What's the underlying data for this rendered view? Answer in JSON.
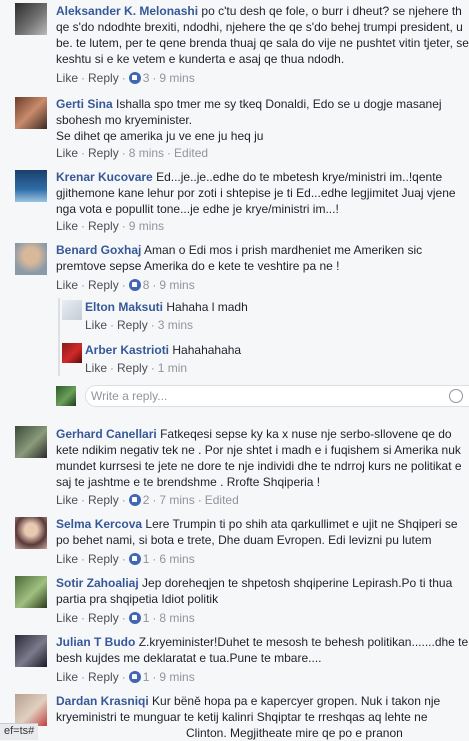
{
  "comments": [
    {
      "name": "Aleksander K. Melonashi",
      "lines": [
        "po c'tu desh qe fole, o burr i dheut? se njehere th",
        "qe s'do ndodhte brexiti, ndodhi, njehere the qe s'do behej trumpi president, u",
        "be. te lutem, per te qene brenda thuaj qe sala do vije ne pushtet vitin tjeter, se",
        "keshtu si e ke vetem e kunderta e asaj qe thua ndodh."
      ],
      "like": "Like",
      "reply": "Reply",
      "reactions": "3",
      "time": "9 mins",
      "edited": ""
    },
    {
      "name": "Gerti Sina",
      "lines": [
        "Ishalla spo tmer me sy tkeq Donaldi, Edo se u dogje masanej",
        "sbohesh mo kryeminister.",
        "Se dihet qe amerika ju ve ene ju heq ju"
      ],
      "like": "Like",
      "reply": "Reply",
      "reactions": "",
      "time": "8 mins",
      "edited": "Edited"
    },
    {
      "name": "Krenar Kucovare",
      "lines": [
        "Ed...je..je..edhe do te mbetesh krye/ministri im..!qente",
        "gjithemone kane lehur por zoti i shtepise je ti Ed...edhe legjimitet Juaj vjene",
        "nga vota e popullit tone...je edhe je krye/ministri im...!"
      ],
      "like": "Like",
      "reply": "Reply",
      "reactions": "",
      "time": "9 mins",
      "edited": ""
    },
    {
      "name": "Benard Goxhaj",
      "lines": [
        "Aman o Edi mos i prish mardheniet me Ameriken sic",
        "premtove sepse Amerika do e kete te veshtire pa ne !"
      ],
      "like": "Like",
      "reply": "Reply",
      "reactions": "8",
      "time": "9 mins",
      "edited": ""
    },
    {
      "name": "Elton Maksuti",
      "lines": [
        "Hahaha l madh"
      ],
      "like": "Like",
      "reply": "Reply",
      "reactions": "",
      "time": "3 mins",
      "edited": ""
    },
    {
      "name": "Arber Kastrioti",
      "lines": [
        "Hahahahaha"
      ],
      "like": "Like",
      "reply": "Reply",
      "reactions": "",
      "time": "1 min",
      "edited": ""
    },
    {
      "name": "Gerhard Canellari",
      "lines": [
        "Fatkeqesi sepse ky ka x nuse nje serbo-sllovene qe do",
        "kete ndikim negativ tek ne . Por nje shtet i madh e i fuqishem si Amerika nuk",
        "mundet kurrsesi te jete ne dore te nje individi dhe te ndrroj kurs ne politikat e",
        "saj te jashtme e te brendshme . Rrofte Shqiperia !"
      ],
      "like": "Like",
      "reply": "Reply",
      "reactions": "2",
      "time": "7 mins",
      "edited": "Edited"
    },
    {
      "name": "Selma Kercova",
      "lines": [
        "Lere Trumpin ti po shih ata qarkullimet e ujit ne Shqiperi se",
        "po behet nami, si bota e trete, Dhe duam Evropen. Edi levizni pu lutem"
      ],
      "like": "Like",
      "reply": "Reply",
      "reactions": "1",
      "time": "6 mins",
      "edited": ""
    },
    {
      "name": "Sotir Zahoaliaj",
      "lines": [
        "Jep doreheqjen te shpetosh shqiperine Lepirash.Po ti thua",
        "partia pra shqipetia Idiot politik"
      ],
      "like": "Like",
      "reply": "Reply",
      "reactions": "1",
      "time": "8 mins",
      "edited": ""
    },
    {
      "name": "Julian T Budo",
      "lines": [
        "Z.kryeminister!Duhet te mesosh te behesh politikan.......dhe te",
        "besh kujdes me deklaratat e tua.Pune te mbare...."
      ],
      "like": "Like",
      "reply": "Reply",
      "reactions": "1",
      "time": "9 mins",
      "edited": ""
    },
    {
      "name": "Dardan Krasniqi",
      "lines": [
        "Kur bëně hopa pa e kapercyer gropen. Nuk i takon nje",
        "kryeministri te munguar te ketij kalinri Shqiptar te rreshqas aq lehte ne",
        "Clinton. Megjitheate mire qe po e pranon"
      ],
      "like": "",
      "reply": "",
      "reactions": "",
      "time": "",
      "edited": ""
    }
  ],
  "reply_box": {
    "placeholder": "Write a reply..."
  },
  "status_bar": "ef=ts#",
  "colors": {
    "link": "#365899",
    "meta": "#90949c",
    "background": "#f6f7f9"
  }
}
